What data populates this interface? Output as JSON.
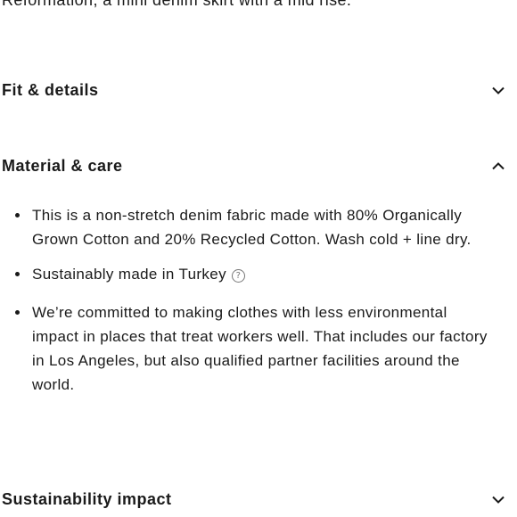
{
  "intro": {
    "text": "Reformation, a mini denim skirt with a mid rise."
  },
  "accordions": {
    "fit": {
      "title": "Fit & details",
      "state": "collapsed",
      "icon": "chevron-down-icon"
    },
    "material": {
      "title": "Material & care",
      "state": "expanded",
      "icon": "chevron-up-icon"
    },
    "sustainability": {
      "title": "Sustainability impact",
      "state": "collapsed",
      "icon": "chevron-down-icon"
    }
  },
  "material_care": {
    "items": [
      {
        "text": "This is a non-stretch denim fabric made with 80% Organically Grown Cotton and 20% Recycled Cotton. Wash cold + line dry."
      },
      {
        "text": "Sustainably made in Turkey",
        "icon": "help-circle-icon",
        "icon_glyph": "?"
      },
      {
        "text": "We’re committed to making clothes with less environmental impact in places that treat workers well. That includes our factory in Los Angeles, but also qualified partner facilities around the world."
      }
    ]
  },
  "colors": {
    "text": "#1a1a1a",
    "background": "#ffffff",
    "muted_icon": "#777777"
  }
}
